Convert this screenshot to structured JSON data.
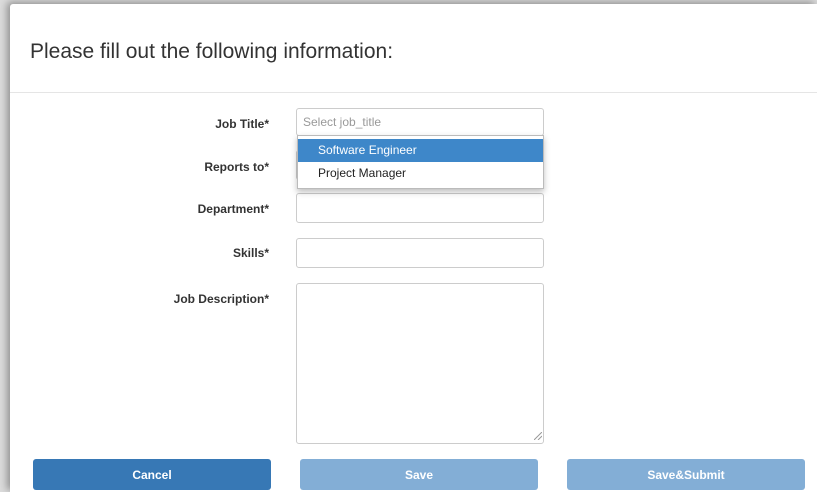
{
  "header": {
    "title": "Please fill out the following information:"
  },
  "form": {
    "job_title": {
      "label": "Job Title*",
      "placeholder": "Select job_title",
      "value": ""
    },
    "reports_to": {
      "label": "Reports to*",
      "value": ""
    },
    "department": {
      "label": "Department*",
      "value": ""
    },
    "skills": {
      "label": "Skills*",
      "value": ""
    },
    "job_description": {
      "label": "Job Description*",
      "value": ""
    }
  },
  "dropdown": {
    "options": [
      {
        "label": "Software Engineer",
        "highlighted": true
      },
      {
        "label": "Project Manager",
        "highlighted": false
      }
    ]
  },
  "buttons": {
    "cancel": "Cancel",
    "save": "Save",
    "save_submit": "Save&Submit"
  },
  "colors": {
    "primary": "#3778b5",
    "muted_button": "#83aed6",
    "highlight": "#3e87c9"
  },
  "icons": {
    "textarea_resize": "resize-grip-icon"
  }
}
